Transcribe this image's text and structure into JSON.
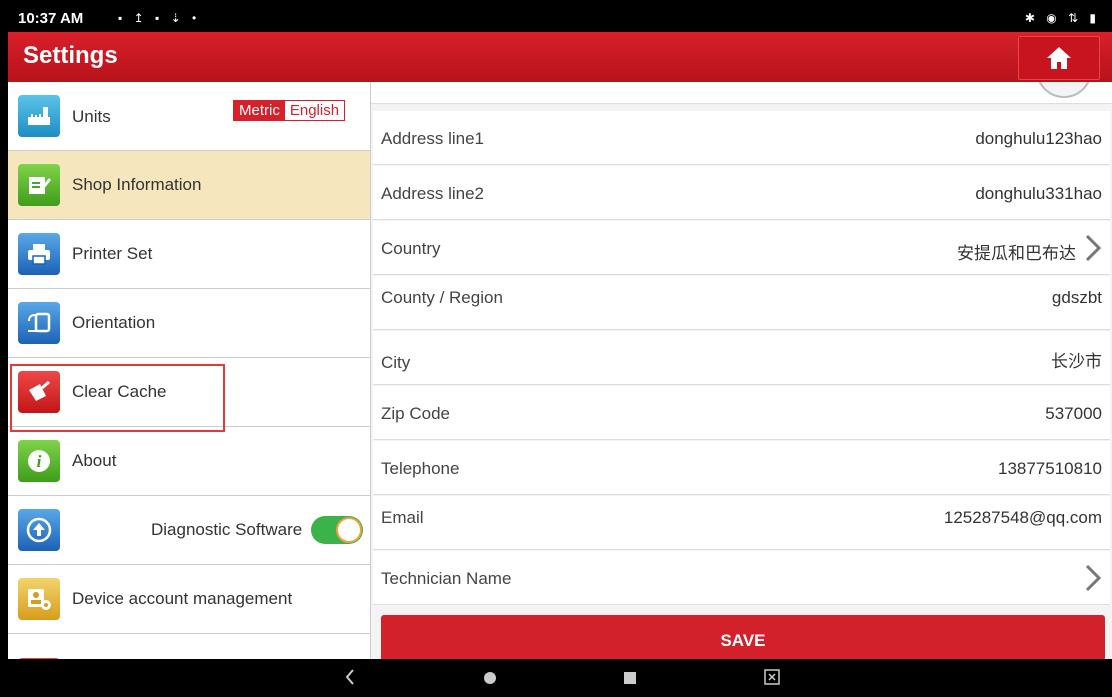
{
  "status_bar": {
    "time": "10:37 AM"
  },
  "header": {
    "title": "Settings",
    "home_icon": "home-icon"
  },
  "sidebar": {
    "items": [
      {
        "label": "Units",
        "icon": "ruler-icon"
      },
      {
        "label": "Shop Information",
        "icon": "edit-document-icon"
      },
      {
        "label": "Printer Set",
        "icon": "printer-icon"
      },
      {
        "label": "Orientation",
        "icon": "rotate-screen-icon"
      },
      {
        "label": "Clear Cache",
        "icon": "broom-icon"
      },
      {
        "label": "About",
        "icon": "info-icon"
      },
      {
        "label": "Diagnostic Software",
        "icon": "upgrade-icon"
      },
      {
        "label": "Device account management",
        "icon": "account-icon"
      }
    ],
    "units_options": {
      "metric": "Metric",
      "english": "English",
      "selected": "Metric"
    },
    "diagnostic_toggle_on": true,
    "active_item": "Shop Information",
    "highlighted_item": "Clear Cache"
  },
  "form": {
    "rows": [
      {
        "label": "Address line1",
        "value": "donghulu123hao"
      },
      {
        "label": "Address line2",
        "value": "donghulu331hao"
      },
      {
        "label": "Country",
        "value": "安提瓜和巴布达"
      },
      {
        "label": "County / Region",
        "value": "gdszbt"
      },
      {
        "label": "City",
        "value": "长沙市"
      },
      {
        "label": "Zip Code",
        "value": "537000"
      },
      {
        "label": "Telephone",
        "value": "13877510810"
      },
      {
        "label": "Email",
        "value": "125287548@qq.com"
      },
      {
        "label": "Technician Name",
        "value": ""
      }
    ],
    "save_label": "SAVE"
  },
  "colors": {
    "brand_red": "#d3212b",
    "active_bg": "#f6e6bd",
    "highlight": "#e23a3a"
  }
}
